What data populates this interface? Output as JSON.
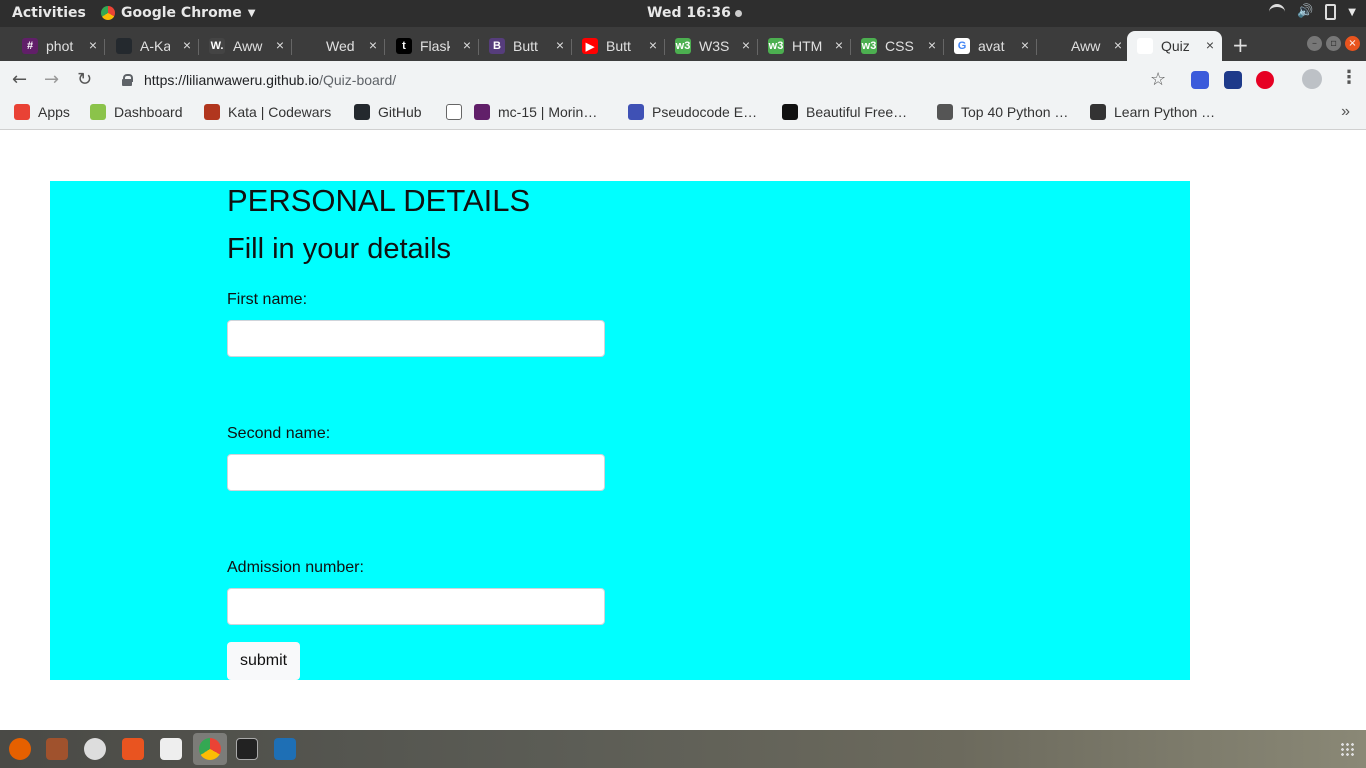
{
  "system": {
    "activities": "Activities",
    "app_name": "Google Chrome",
    "clock": "Wed 16:36"
  },
  "tabs": [
    {
      "title": "phot",
      "color": "#611f69",
      "glyph": "#"
    },
    {
      "title": "A-Ka",
      "color": "#24292e",
      "glyph": ""
    },
    {
      "title": "Aww",
      "color": "#444444",
      "glyph": "W."
    },
    {
      "title": "Wed",
      "color": "#3c3c3c",
      "glyph": ""
    },
    {
      "title": "Flask",
      "color": "#000000",
      "glyph": "t"
    },
    {
      "title": "Butt",
      "color": "#563d7c",
      "glyph": "B"
    },
    {
      "title": "Butt",
      "color": "#ff0000",
      "glyph": "▶"
    },
    {
      "title": "W3S",
      "color": "#4caf50",
      "glyph": "w3"
    },
    {
      "title": "HTM",
      "color": "#4caf50",
      "glyph": "w3"
    },
    {
      "title": "CSS",
      "color": "#4caf50",
      "glyph": "w3"
    },
    {
      "title": "avat",
      "color": "#ffffff",
      "glyph": "G"
    },
    {
      "title": "Aww",
      "color": "#3c3c3c",
      "glyph": ""
    },
    {
      "title": "Quiz",
      "color": "#ffffff",
      "glyph": ""
    }
  ],
  "toolbar": {
    "url_host": "https://lilianwaweru.github.io",
    "url_path": "/Quiz-board/"
  },
  "bookmarks": [
    {
      "label": "Apps",
      "color": "#e94235"
    },
    {
      "label": "Dashboard",
      "color": "#8bc34a"
    },
    {
      "label": "Kata | Codewars",
      "color": "#b1361e"
    },
    {
      "label": "GitHub",
      "color": "#24292e"
    },
    {
      "label": "",
      "color": "#ffffff"
    },
    {
      "label": "mc-15 | Morin…",
      "color": "#611f69"
    },
    {
      "label": "Pseudocode E…",
      "color": "#3f51b5"
    },
    {
      "label": "Beautiful Free…",
      "color": "#111111"
    },
    {
      "label": "Top 40 Python …",
      "color": "#555555"
    },
    {
      "label": "Learn Python …",
      "color": "#333333"
    }
  ],
  "page": {
    "title": "PERSONAL DETAILS",
    "subtitle": "Fill in your details",
    "first_name_label": "First name:",
    "second_name_label": "Second name:",
    "admission_label": "Admission number:",
    "first_name_value": "",
    "second_name_value": "",
    "admission_value": "",
    "submit_label": "submit",
    "panel_color": "#00ffff"
  }
}
